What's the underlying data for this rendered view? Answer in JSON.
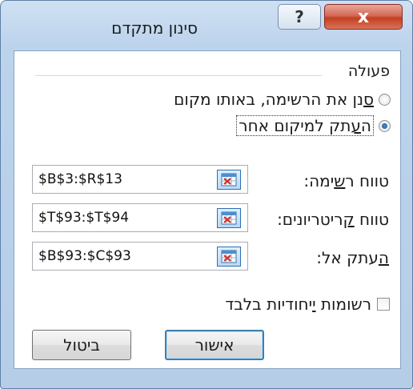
{
  "window": {
    "title": "סינון מתקדם",
    "help_label": "?",
    "close_label": "x"
  },
  "action": {
    "section_label": "פעולה",
    "options": [
      {
        "label_pre": "",
        "label_accel": "ס",
        "label_post": "נן את הרשימה, באותו מקום",
        "selected": false
      },
      {
        "label_pre": "ה",
        "label_accel": "ע",
        "label_post": "תק למיקום אחר",
        "selected": true
      }
    ]
  },
  "fields": [
    {
      "label_pre": "טווח ר",
      "label_accel": "ש",
      "label_post": "ימה:",
      "value": "$B$3:$R$13",
      "button_icon": "collapse-dialog-icon"
    },
    {
      "label_pre": "טווח ",
      "label_accel": "ק",
      "label_post": "ריטריונים:",
      "value": "$T$93:$T$94",
      "button_icon": "collapse-dialog-icon"
    },
    {
      "label_pre": "",
      "label_accel": "ה",
      "label_post": "עתק אל:",
      "value": "$B$93:$C$93",
      "button_icon": "collapse-dialog-icon"
    }
  ],
  "unique_records": {
    "label_pre": "רשומות ",
    "label_accel": "י",
    "label_post": "יחודיות בלבד",
    "checked": false
  },
  "buttons": {
    "ok_label": "אישור",
    "cancel_label": "ביטול"
  }
}
